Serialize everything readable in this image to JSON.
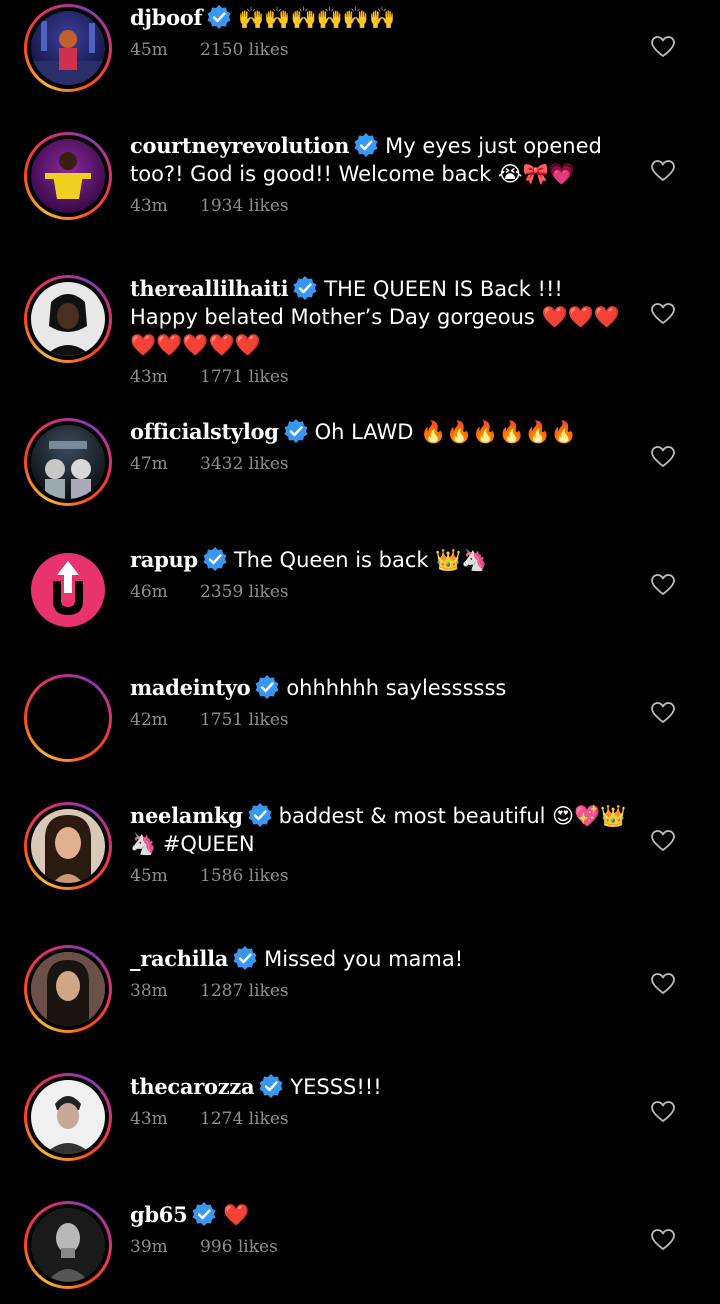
{
  "comments": [
    {
      "username": "djboof",
      "text": "🙌🙌🙌🙌🙌🙌",
      "time": "45m",
      "likes": "2150 likes"
    },
    {
      "username": "courtneyrevolution",
      "text": "My eyes just opened too?! God is good!! Welcome back 😭🎀💗",
      "time": "43m",
      "likes": "1934 likes"
    },
    {
      "username": "thereallilhaiti",
      "text": "THE QUEEN IS Back !!! Happy belated Mother’s Day gorgeous ❤️❤️❤️❤️❤️❤️❤️❤️",
      "time": "43m",
      "likes": "1771 likes"
    },
    {
      "username": "officialstylog",
      "text": "Oh LAWD 🔥🔥🔥🔥🔥🔥",
      "time": "47m",
      "likes": "3432 likes"
    },
    {
      "username": "rapup",
      "text": "The Queen is back 👑🦄",
      "time": "46m",
      "likes": "2359 likes"
    },
    {
      "username": "madeintyo",
      "text": "ohhhhhh saylessssss",
      "time": "42m",
      "likes": "1751 likes"
    },
    {
      "username": "neelamkg",
      "text": "baddest & most beautiful 😍💖👑🦄 #QUEEN",
      "time": "45m",
      "likes": "1586 likes"
    },
    {
      "username": "_rachilla",
      "text": "Missed you mama!",
      "time": "38m",
      "likes": "1287 likes"
    },
    {
      "username": "thecarozza",
      "text": "YESSS!!!",
      "time": "43m",
      "likes": "1274 likes"
    },
    {
      "username": "gb65",
      "text": "❤️",
      "time": "39m",
      "likes": "996 likes"
    }
  ],
  "icons": {
    "verified": "verified-badge-icon",
    "like": "heart-outline-icon",
    "verified_color": "#3897f0"
  }
}
